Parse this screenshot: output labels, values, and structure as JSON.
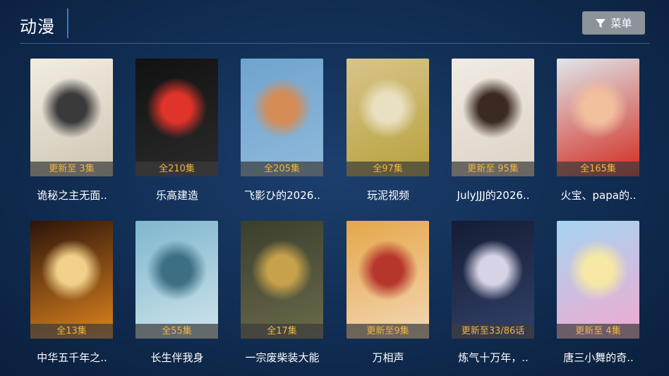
{
  "header": {
    "title": "动漫",
    "menu_label": "菜单",
    "menu_icon": "filter-icon"
  },
  "rows": [
    [
      {
        "badge": "更新至 3集",
        "name": "诡秘之主无面..",
        "colors": [
          "#f2ede2",
          "#cfc6b3",
          "#3a3a3a"
        ]
      },
      {
        "badge": "全210集",
        "name": "乐高建造",
        "colors": [
          "#111111",
          "#2b2b2b",
          "#e0332a"
        ]
      },
      {
        "badge": "全205集",
        "name": "飞影ひ的2026..",
        "colors": [
          "#6fa4cf",
          "#8fb9da",
          "#d68c55"
        ]
      },
      {
        "badge": "全97集",
        "name": "玩泥视频",
        "colors": [
          "#d8c48a",
          "#b7a13d",
          "#e8e0c0"
        ]
      },
      {
        "badge": "更新至 95集",
        "name": "JulyJJJ的2026..",
        "colors": [
          "#f0ebe4",
          "#ddd3c6",
          "#3b2a22"
        ]
      },
      {
        "badge": "全165集",
        "name": "火宝、papa的..",
        "colors": [
          "#dfe6ea",
          "#d12a1f",
          "#f3c09e"
        ]
      }
    ],
    [
      {
        "badge": "全13集",
        "name": "中华五千年之..",
        "colors": [
          "#2c1409",
          "#e0841f",
          "#f1d18a"
        ]
      },
      {
        "badge": "全55集",
        "name": "长生伴我身",
        "colors": [
          "#7fb6cf",
          "#cfe5ea",
          "#3c6e84"
        ]
      },
      {
        "badge": "全17集",
        "name": "一宗废柴装大能",
        "colors": [
          "#3a3f2d",
          "#6b6a4a",
          "#c8a24b"
        ]
      },
      {
        "badge": "更新至9集",
        "name": "万相声",
        "colors": [
          "#e5a74a",
          "#f3d8b6",
          "#b6362c"
        ]
      },
      {
        "badge": "更新至33/86话",
        "name": "炼气十万年，..",
        "colors": [
          "#141d33",
          "#33406a",
          "#d6d3e6"
        ]
      },
      {
        "badge": "更新至 4集",
        "name": "唐三小舞的奇..",
        "colors": [
          "#a6d4f2",
          "#f2a9cf",
          "#f7e8a6"
        ]
      }
    ]
  ]
}
